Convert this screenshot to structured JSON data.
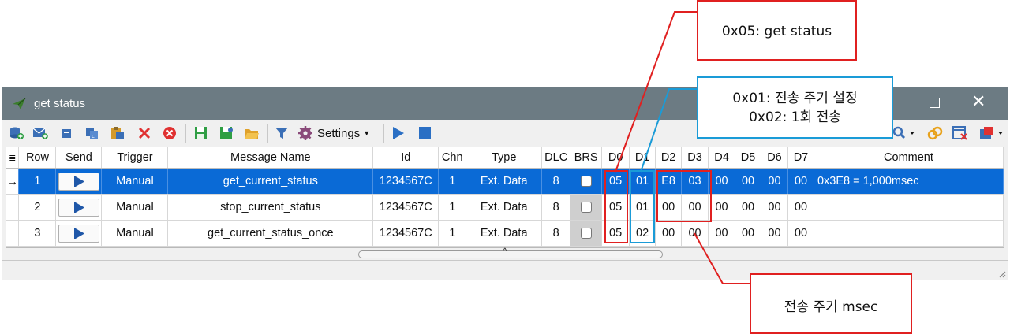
{
  "window": {
    "title": "get status",
    "app_icon": "paper-plane-icon",
    "maximize_icon": "maximize-icon",
    "close_icon": "close-icon",
    "close_glyph": "✕"
  },
  "toolbar": {
    "settings_label": "Settings",
    "icons": [
      "database-add-icon",
      "mail-add-icon",
      "copy-icon",
      "copy-special-icon",
      "paste-icon",
      "delete-icon",
      "delete-all-icon",
      "save-icon",
      "save-as-icon",
      "open-folder-icon",
      "filter-icon",
      "settings-gear-icon",
      "play-icon",
      "stop-icon",
      "search-icon",
      "link-icon",
      "delete-rows-icon",
      "export-icon"
    ]
  },
  "table": {
    "columns": [
      "Row",
      "Send",
      "Trigger",
      "Message Name",
      "Id",
      "Chn",
      "Type",
      "DLC",
      "BRS",
      "D0",
      "D1",
      "D2",
      "D3",
      "D4",
      "D5",
      "D6",
      "D7",
      "Comment"
    ],
    "current_row_marker": "→",
    "rows": [
      {
        "row": "1",
        "trigger": "Manual",
        "name": "get_current_status",
        "id": "1234567C",
        "chn": "1",
        "type": "Ext. Data",
        "dlc": "8",
        "d": [
          "05",
          "01",
          "E8",
          "03",
          "00",
          "00",
          "00",
          "00"
        ],
        "comment": "0x3E8 = 1,000msec"
      },
      {
        "row": "2",
        "trigger": "Manual",
        "name": "stop_current_status",
        "id": "1234567C",
        "chn": "1",
        "type": "Ext. Data",
        "dlc": "8",
        "d": [
          "05",
          "01",
          "00",
          "00",
          "00",
          "00",
          "00",
          "00"
        ],
        "comment": ""
      },
      {
        "row": "3",
        "trigger": "Manual",
        "name": "get_current_status_once",
        "id": "1234567C",
        "chn": "1",
        "type": "Ext. Data",
        "dlc": "8",
        "d": [
          "05",
          "02",
          "00",
          "00",
          "00",
          "00",
          "00",
          "00"
        ],
        "comment": ""
      }
    ]
  },
  "callouts": {
    "d0": "0x05: get status",
    "d1_line1": "0x01: 전송 주기 설정",
    "d1_line2": "0x02: 1회 전송",
    "d2d3": "전송 주기 msec"
  },
  "colors": {
    "title_bar": "#6c7b83",
    "selection": "#0a6ad6",
    "callout_red": "#e02020",
    "callout_blue": "#1a9bd7"
  }
}
